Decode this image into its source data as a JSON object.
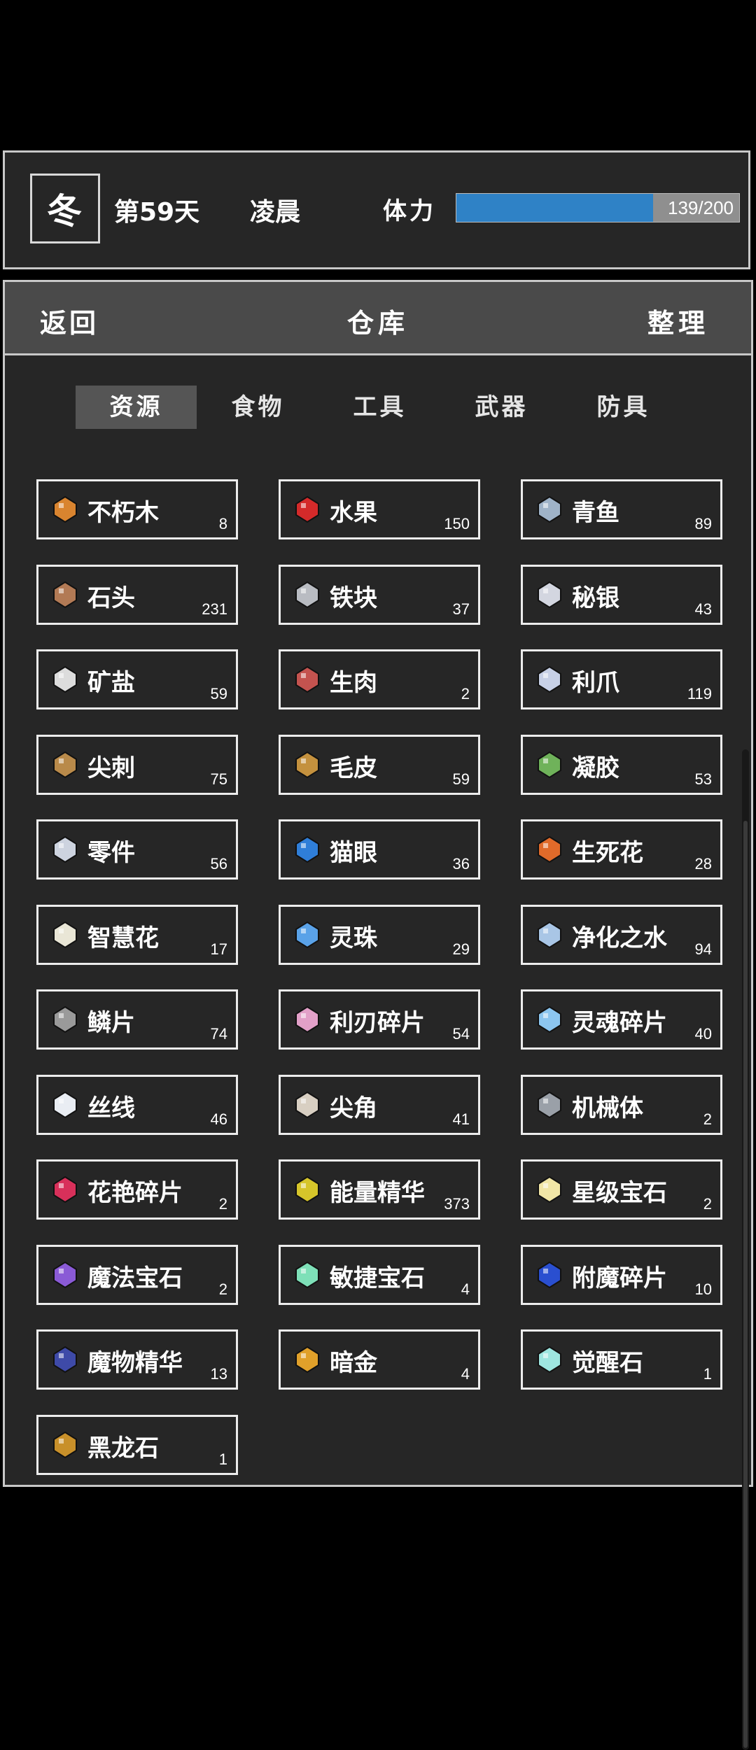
{
  "status": {
    "season": "冬",
    "day": "第59天",
    "time_of_day": "凌晨",
    "stamina_label": "体力",
    "stamina_text": "139/200",
    "stamina_current": 139,
    "stamina_max": 200
  },
  "header": {
    "back_label": "返回",
    "title": "仓库",
    "sort_label": "整理"
  },
  "tabs": [
    {
      "label": "资源",
      "active": true
    },
    {
      "label": "食物",
      "active": false
    },
    {
      "label": "工具",
      "active": false
    },
    {
      "label": "武器",
      "active": false
    },
    {
      "label": "防具",
      "active": false
    }
  ],
  "items": [
    {
      "name": "不朽木",
      "count": "8",
      "icon": "wood-icon",
      "color": "#d9842f"
    },
    {
      "name": "水果",
      "count": "150",
      "icon": "apple-icon",
      "color": "#d42a2a"
    },
    {
      "name": "青鱼",
      "count": "89",
      "icon": "fish-icon",
      "color": "#9fb3c8"
    },
    {
      "name": "石头",
      "count": "231",
      "icon": "stone-icon",
      "color": "#b27a55"
    },
    {
      "name": "铁块",
      "count": "37",
      "icon": "iron-ingot-icon",
      "color": "#b9bcc2"
    },
    {
      "name": "秘银",
      "count": "43",
      "icon": "mithril-icon",
      "color": "#d3d6e0"
    },
    {
      "name": "矿盐",
      "count": "59",
      "icon": "salt-icon",
      "color": "#dcdcdc"
    },
    {
      "name": "生肉",
      "count": "2",
      "icon": "raw-meat-icon",
      "color": "#c4534f"
    },
    {
      "name": "利爪",
      "count": "119",
      "icon": "claw-icon",
      "color": "#c7d0e6"
    },
    {
      "name": "尖刺",
      "count": "75",
      "icon": "spike-icon",
      "color": "#b98a4a"
    },
    {
      "name": "毛皮",
      "count": "59",
      "icon": "fur-icon",
      "color": "#c4913e"
    },
    {
      "name": "凝胶",
      "count": "53",
      "icon": "gel-icon",
      "color": "#6fb25a"
    },
    {
      "name": "零件",
      "count": "56",
      "icon": "parts-icon",
      "color": "#cdd3df"
    },
    {
      "name": "猫眼",
      "count": "36",
      "icon": "cat-eye-icon",
      "color": "#2f7ed8"
    },
    {
      "name": "生死花",
      "count": "28",
      "icon": "life-death-flower-icon",
      "color": "#e06a2a"
    },
    {
      "name": "智慧花",
      "count": "17",
      "icon": "wisdom-flower-icon",
      "color": "#e9e6d6"
    },
    {
      "name": "灵珠",
      "count": "29",
      "icon": "spirit-orb-icon",
      "color": "#5aa2e8"
    },
    {
      "name": "净化之水",
      "count": "94",
      "icon": "purified-water-icon",
      "color": "#a9c6e6"
    },
    {
      "name": "鳞片",
      "count": "74",
      "icon": "scale-icon",
      "color": "#9a9a9a"
    },
    {
      "name": "利刃碎片",
      "count": "54",
      "icon": "blade-shard-icon",
      "color": "#e2a0c8"
    },
    {
      "name": "灵魂碎片",
      "count": "40",
      "icon": "soul-shard-icon",
      "color": "#8cc6f0"
    },
    {
      "name": "丝线",
      "count": "46",
      "icon": "thread-icon",
      "color": "#e9edf3"
    },
    {
      "name": "尖角",
      "count": "41",
      "icon": "horn-icon",
      "color": "#d8cfc2"
    },
    {
      "name": "机械体",
      "count": "2",
      "icon": "mechanism-icon",
      "color": "#9aa0a8"
    },
    {
      "name": "花艳碎片",
      "count": "2",
      "icon": "flower-shard-icon",
      "color": "#d8305a"
    },
    {
      "name": "能量精华",
      "count": "373",
      "icon": "energy-essence-icon",
      "color": "#d6c52a"
    },
    {
      "name": "星级宝石",
      "count": "2",
      "icon": "star-gem-icon",
      "color": "#f1e6a6"
    },
    {
      "name": "魔法宝石",
      "count": "2",
      "icon": "magic-gem-icon",
      "color": "#8a5ad6"
    },
    {
      "name": "敏捷宝石",
      "count": "4",
      "icon": "agility-gem-icon",
      "color": "#7ee0b8"
    },
    {
      "name": "附魔碎片",
      "count": "10",
      "icon": "enchant-shard-icon",
      "color": "#2a4fd0"
    },
    {
      "name": "魔物精华",
      "count": "13",
      "icon": "monster-essence-icon",
      "color": "#3e4aa8"
    },
    {
      "name": "暗金",
      "count": "4",
      "icon": "dark-gold-icon",
      "color": "#e0a02a"
    },
    {
      "name": "觉醒石",
      "count": "1",
      "icon": "awakening-stone-icon",
      "color": "#9ee6e0"
    },
    {
      "name": "黑龙石",
      "count": "1",
      "icon": "black-dragon-stone-icon",
      "color": "#c8902a"
    }
  ]
}
